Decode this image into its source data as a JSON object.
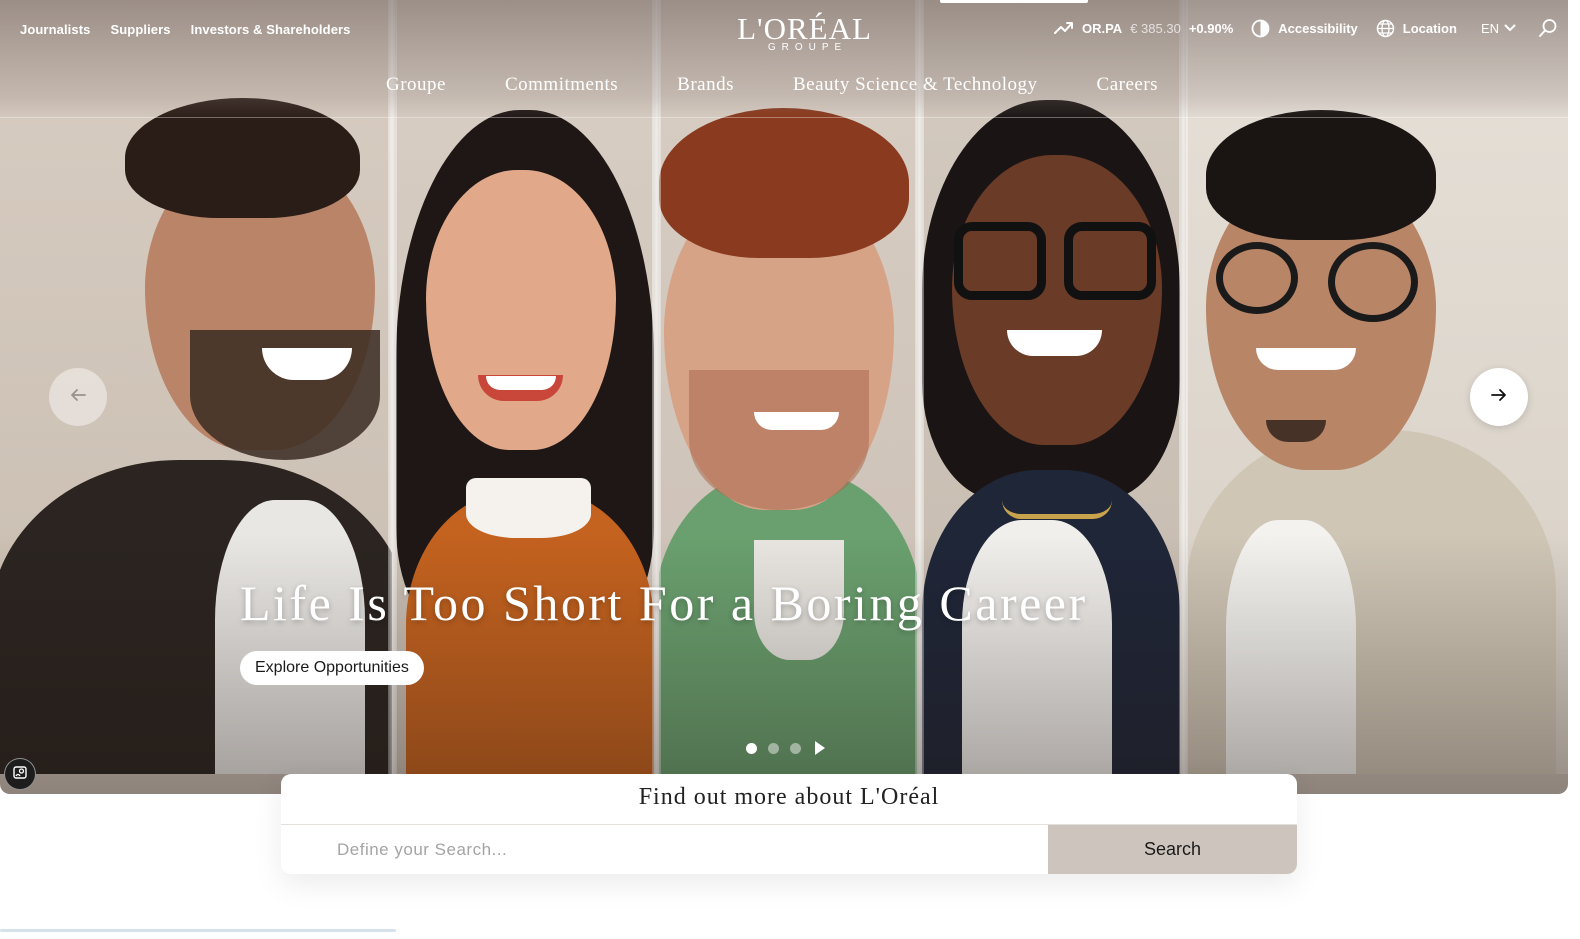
{
  "utility_links": [
    "Journalists",
    "Suppliers",
    "Investors & Shareholders"
  ],
  "logo": {
    "brand": "L'ORÉAL",
    "sub": "GROUPE"
  },
  "stock": {
    "ticker": "OR.PA",
    "price": "€ 385.30",
    "change": "+0.90%"
  },
  "tools": {
    "accessibility": "Accessibility",
    "location": "Location",
    "language": "EN"
  },
  "main_nav": [
    "Groupe",
    "Commitments",
    "Brands",
    "Beauty Science & Technology",
    "Careers"
  ],
  "hero": {
    "headline": "Life Is Too Short For a Boring Career",
    "cta": "Explore Opportunities",
    "slides_total": 3,
    "active_slide": 1
  },
  "search": {
    "title": "Find out more about L'Oréal",
    "placeholder": "Define your Search...",
    "button": "Search"
  },
  "colors": {
    "search_button_bg": "#cdc5bd",
    "hero_bg": "#c9bfb5"
  },
  "icons": [
    "trend-up-icon",
    "contrast-icon",
    "globe-icon",
    "chevron-down-icon",
    "search-icon",
    "arrow-left-icon",
    "arrow-right-icon",
    "play-icon",
    "cookie-settings-icon"
  ]
}
